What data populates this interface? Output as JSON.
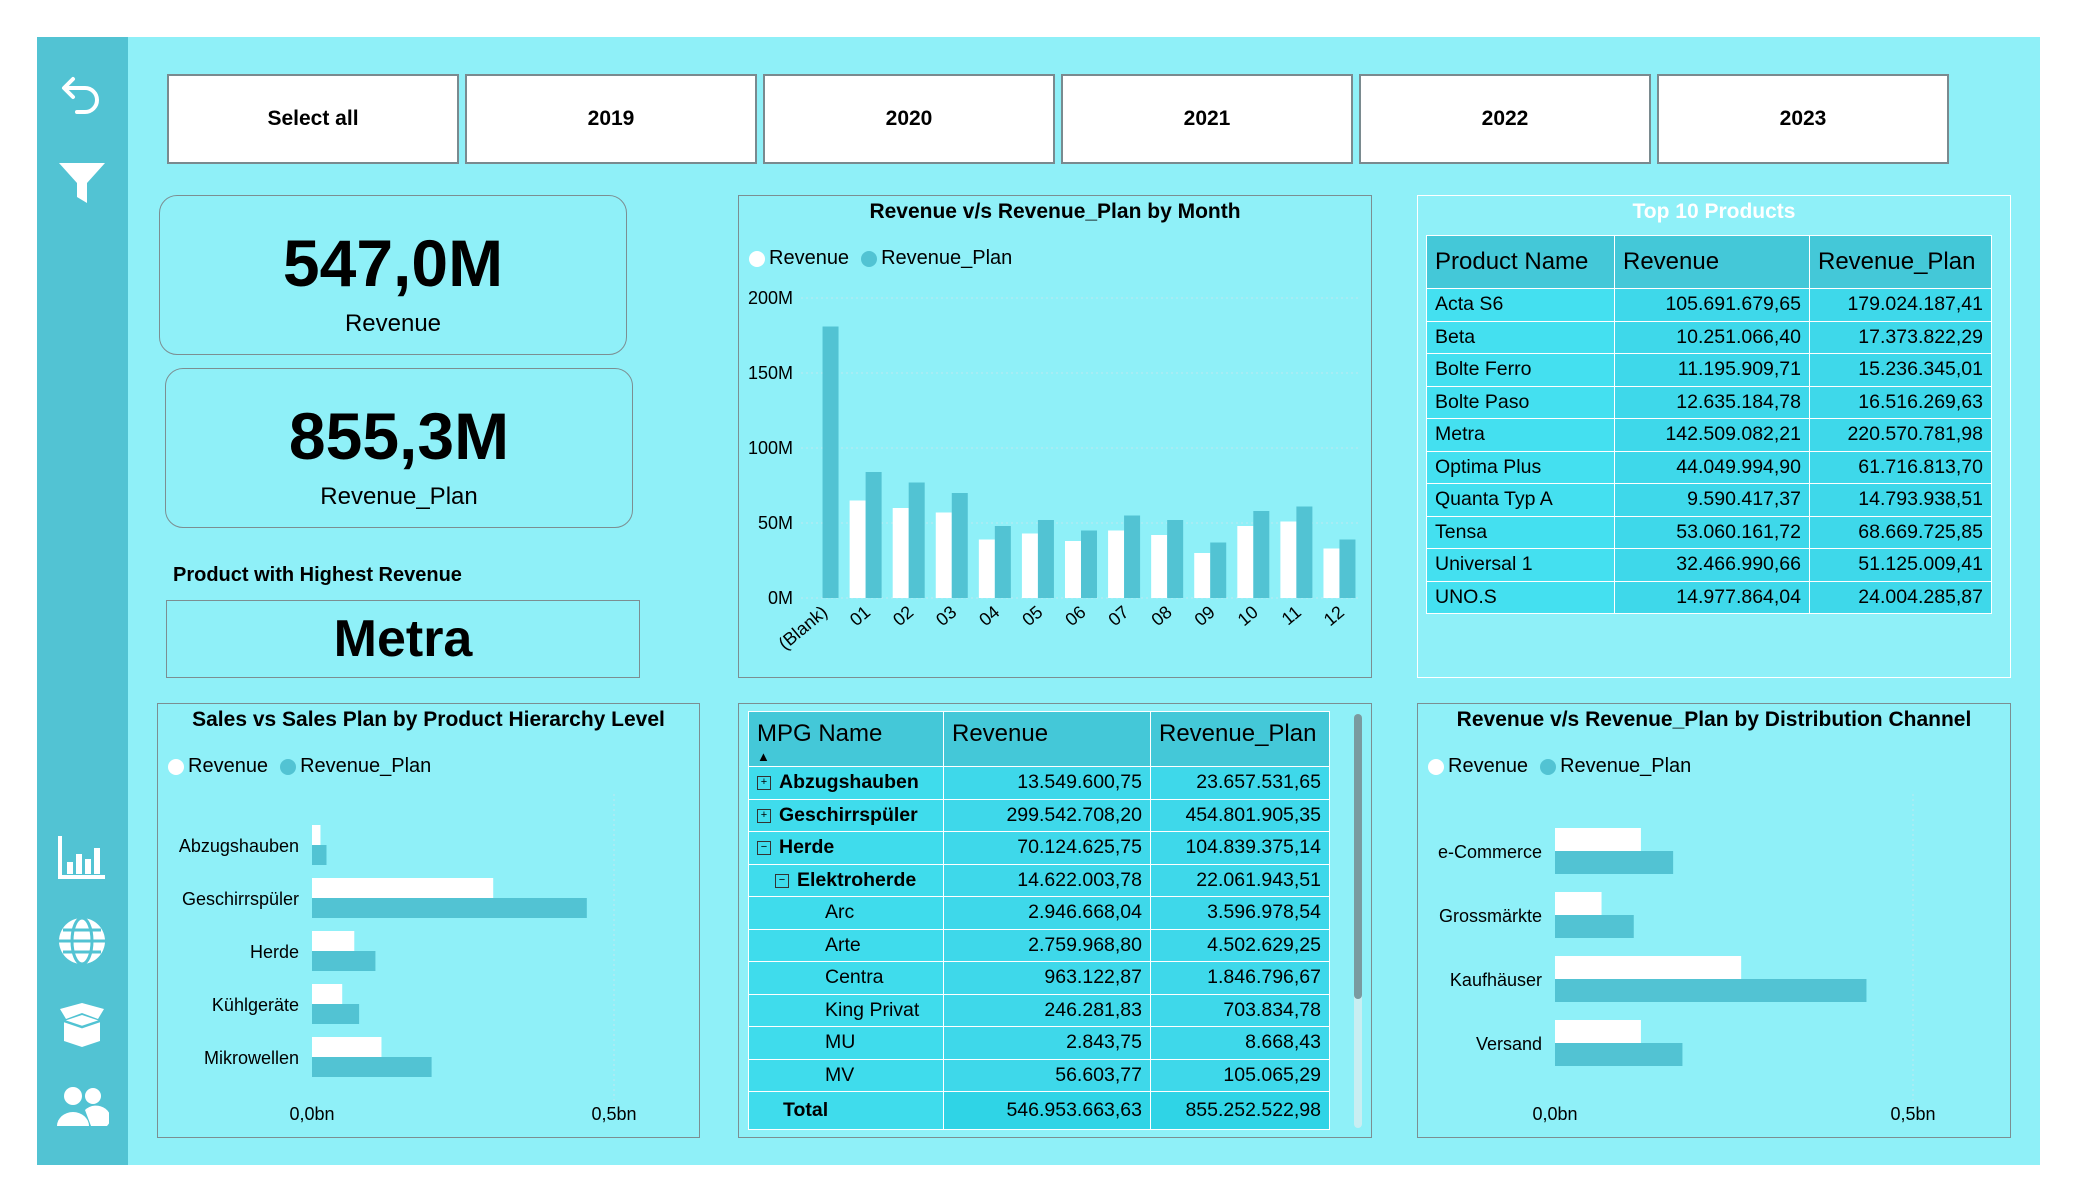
{
  "sidebar": {
    "icons": [
      "back-icon",
      "filter-icon",
      "chart-icon",
      "globe-icon",
      "box-icon",
      "users-icon"
    ]
  },
  "slicer": [
    "Select all",
    "2019",
    "2020",
    "2021",
    "2022",
    "2023"
  ],
  "kpi": {
    "revenue": {
      "value": "547,0M",
      "label": "Revenue"
    },
    "plan": {
      "value": "855,3M",
      "label": "Revenue_Plan"
    }
  },
  "highest": {
    "caption": "Product with Highest Revenue",
    "value": "Metra"
  },
  "colors": {
    "revenue": "#ffffff",
    "plan": "#52c3d3",
    "background": "#8ff0f8",
    "sidebar": "#52c3d3"
  },
  "month_chart": {
    "title": "Revenue v/s Revenue_Plan by Month",
    "legend": [
      "Revenue",
      "Revenue_Plan"
    ],
    "chart_data": {
      "type": "bar",
      "categories": [
        "(Blank)",
        "01",
        "02",
        "03",
        "04",
        "05",
        "06",
        "07",
        "08",
        "09",
        "10",
        "11",
        "12"
      ],
      "series": [
        {
          "name": "Revenue",
          "values": [
            0,
            65,
            60,
            57,
            39,
            43,
            38,
            45,
            42,
            30,
            48,
            51,
            33
          ]
        },
        {
          "name": "Revenue_Plan",
          "values": [
            181,
            84,
            77,
            70,
            48,
            52,
            45,
            55,
            52,
            37,
            58,
            61,
            39
          ]
        }
      ],
      "yticks": [
        "0M",
        "50M",
        "100M",
        "150M",
        "200M"
      ],
      "ylim": [
        0,
        200
      ]
    }
  },
  "top_products": {
    "title": "Top 10 Products",
    "columns": [
      "Product Name",
      "Revenue",
      "Revenue_Plan"
    ],
    "rows": [
      [
        "Acta S6",
        "105.691.679,65",
        "179.024.187,41"
      ],
      [
        "Beta",
        "10.251.066,40",
        "17.373.822,29"
      ],
      [
        "Bolte Ferro",
        "11.195.909,71",
        "15.236.345,01"
      ],
      [
        "Bolte Paso",
        "12.635.184,78",
        "16.516.269,63"
      ],
      [
        "Metra",
        "142.509.082,21",
        "220.570.781,98"
      ],
      [
        "Optima Plus",
        "44.049.994,90",
        "61.716.813,70"
      ],
      [
        "Quanta Typ A",
        "9.590.417,37",
        "14.793.938,51"
      ],
      [
        "Tensa",
        "53.060.161,72",
        "68.669.725,85"
      ],
      [
        "Universal 1",
        "32.466.990,66",
        "51.125.009,41"
      ],
      [
        "UNO.S",
        "14.977.864,04",
        "24.004.285,87"
      ]
    ]
  },
  "hierarchy_chart": {
    "title": "Sales vs Sales Plan by Product Hierarchy Level",
    "legend": [
      "Revenue",
      "Revenue_Plan"
    ],
    "chart_data": {
      "type": "bar",
      "orientation": "horizontal",
      "categories": [
        "Abzugshauben",
        "Geschirrspüler",
        "Herde",
        "Kühlgeräte",
        "Mikrowellen"
      ],
      "series": [
        {
          "name": "Revenue",
          "values": [
            0.014,
            0.3,
            0.07,
            0.05,
            0.115
          ]
        },
        {
          "name": "Revenue_Plan",
          "values": [
            0.024,
            0.455,
            0.105,
            0.078,
            0.198
          ]
        }
      ],
      "xticks": [
        "0,0bn",
        "0,5bn"
      ],
      "xlim": [
        0,
        0.5
      ]
    }
  },
  "mpg_table": {
    "columns": [
      "MPG Name",
      "Revenue",
      "Revenue_Plan"
    ],
    "rows": [
      {
        "level": 0,
        "expander": "+",
        "name": "Abzugshauben",
        "revenue": "13.549.600,75",
        "plan": "23.657.531,65",
        "bold": true
      },
      {
        "level": 0,
        "expander": "+",
        "name": "Geschirrspüler",
        "revenue": "299.542.708,20",
        "plan": "454.801.905,35",
        "bold": true
      },
      {
        "level": 0,
        "expander": "−",
        "name": "Herde",
        "revenue": "70.124.625,75",
        "plan": "104.839.375,14",
        "bold": true
      },
      {
        "level": 1,
        "expander": "−",
        "name": "Elektroherde",
        "revenue": "14.622.003,78",
        "plan": "22.061.943,51",
        "bold": true
      },
      {
        "level": 2,
        "expander": "",
        "name": "Arc",
        "revenue": "2.946.668,04",
        "plan": "3.596.978,54",
        "bold": false
      },
      {
        "level": 2,
        "expander": "",
        "name": "Arte",
        "revenue": "2.759.968,80",
        "plan": "4.502.629,25",
        "bold": false
      },
      {
        "level": 2,
        "expander": "",
        "name": "Centra",
        "revenue": "963.122,87",
        "plan": "1.846.796,67",
        "bold": false
      },
      {
        "level": 2,
        "expander": "",
        "name": "King Privat",
        "revenue": "246.281,83",
        "plan": "703.834,78",
        "bold": false
      },
      {
        "level": 2,
        "expander": "",
        "name": "MU",
        "revenue": "2.843,75",
        "plan": "8.668,43",
        "bold": false
      },
      {
        "level": 2,
        "expander": "",
        "name": "MV",
        "revenue": "56.603,77",
        "plan": "105.065,29",
        "bold": false
      }
    ],
    "total": {
      "label": "Total",
      "revenue": "546.953.663,63",
      "plan": "855.252.522,98"
    }
  },
  "channel_chart": {
    "title": "Revenue v/s Revenue_Plan by Distribution Channel",
    "legend": [
      "Revenue",
      "Revenue_Plan"
    ],
    "chart_data": {
      "type": "bar",
      "orientation": "horizontal",
      "categories": [
        "e-Commerce",
        "Grossmärkte",
        "Kaufhäuser",
        "Versand"
      ],
      "series": [
        {
          "name": "Revenue",
          "values": [
            0.12,
            0.065,
            0.26,
            0.12
          ]
        },
        {
          "name": "Revenue_Plan",
          "values": [
            0.165,
            0.11,
            0.435,
            0.178
          ]
        }
      ],
      "xticks": [
        "0,0bn",
        "0,5bn"
      ],
      "xlim": [
        0,
        0.5
      ]
    }
  }
}
